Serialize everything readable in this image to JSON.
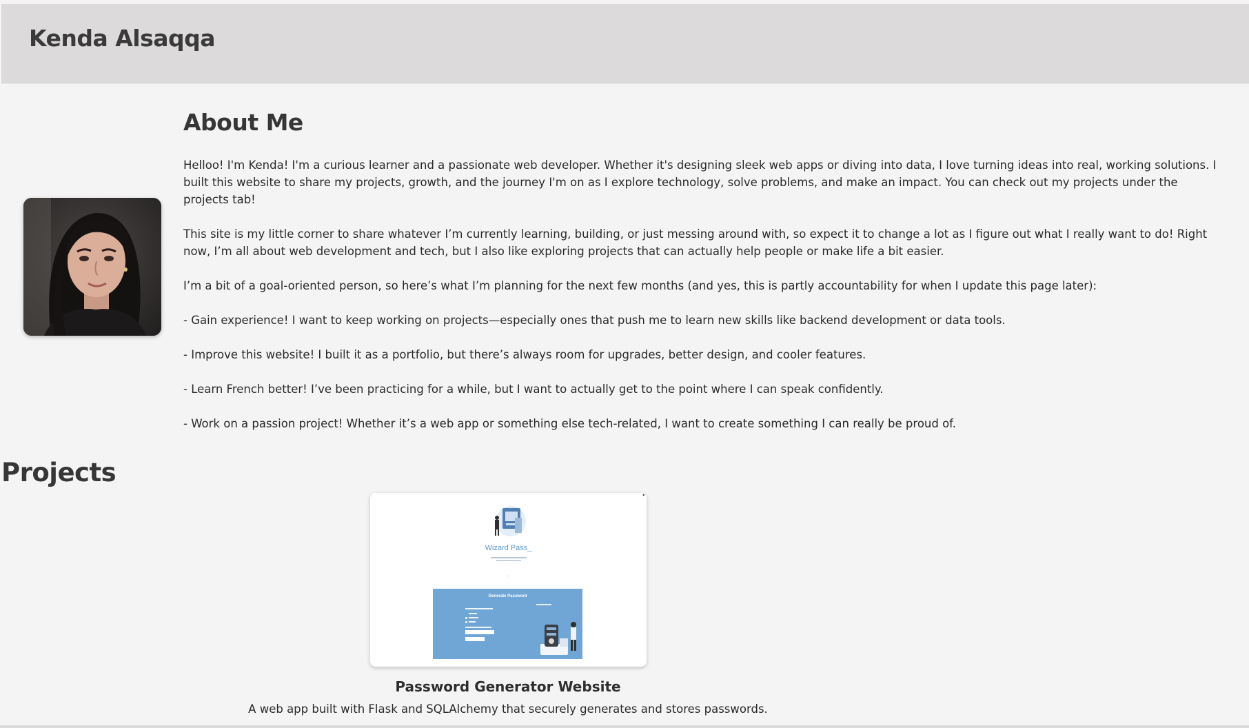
{
  "header": {
    "title": "Kenda Alsaqqa"
  },
  "about": {
    "heading": "About Me",
    "paragraphs": [
      "Helloo! I'm Kenda! I'm a curious learner and a passionate web developer. Whether it's designing sleek web apps or diving into data, I love turning ideas into real, working solutions. I built this website to share my projects, growth, and the journey I'm on as I explore technology, solve problems, and make an impact. You can check out my projects under the projects tab!",
      "This site is my little corner to share whatever I’m currently learning, building, or just messing around with, so expect it to change a lot as I figure out what I really want to do! Right now, I’m all about web development and tech, but I also like exploring projects that can actually help people or make life a bit easier.",
      "I’m a bit of a goal-oriented person, so here’s what I’m planning for the next few months (and yes, this is partly accountability for when I update this page later):",
      "- Gain experience! I want to keep working on projects—especially ones that push me to learn new skills like backend development or data tools.",
      "- Improve this website! I built it as a portfolio, but there’s always room for upgrades, better design, and cooler features.",
      "- Learn French better! I’ve been practicing for a while, but I want to actually get to the point where I can speak confidently.",
      "- Work on a passion project! Whether it’s a web app or something else tech-related, I want to create something I can really be proud of."
    ]
  },
  "projects": {
    "heading": "Projects",
    "items": [
      {
        "name": "Password Generator Website",
        "description": "A web app built with Flask and SQLAlchemy that securely generates and stores passwords.",
        "screenshot": {
          "brand": "Wizard Pass_",
          "panel_title": "Generate Password"
        }
      }
    ]
  },
  "colors": {
    "header_bg": "#dcdadb",
    "page_bg": "#f4f4f4",
    "accent_blue": "#6fa6d6"
  }
}
